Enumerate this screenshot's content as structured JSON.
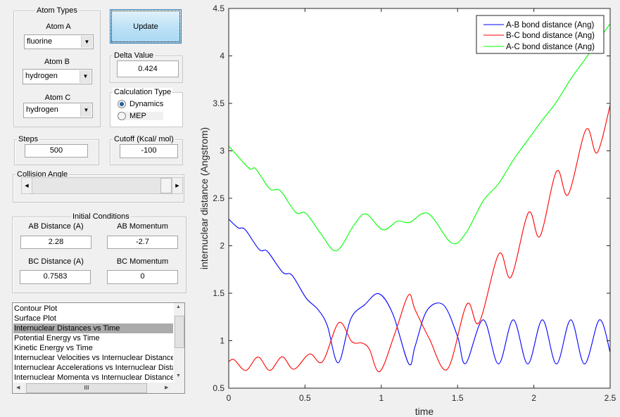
{
  "atom_types": {
    "title": "Atom Types",
    "atom_a": {
      "label": "Atom A",
      "value": "fluorine"
    },
    "atom_b": {
      "label": "Atom B",
      "value": "hydrogen"
    },
    "atom_c": {
      "label": "Atom C",
      "value": "hydrogen"
    }
  },
  "update_label": "Update",
  "delta": {
    "title": "Delta Value",
    "value": "0.424"
  },
  "calc_type": {
    "title": "Calculation Type",
    "options": [
      "Dynamics",
      "MEP"
    ],
    "selected": "Dynamics"
  },
  "steps": {
    "title": "Steps",
    "value": "500"
  },
  "cutoff": {
    "title": "Cutoff (Kcal/ mol)",
    "value": "-100"
  },
  "collision_angle": {
    "title": "Collision Angle",
    "slider_fraction": 1.0
  },
  "initial_conditions": {
    "title": "Initial Conditions",
    "ab_distance": {
      "label": "AB Distance (A)",
      "value": "2.28"
    },
    "ab_momentum": {
      "label": "AB Momentum",
      "value": "-2.7"
    },
    "bc_distance": {
      "label": "BC Distance (A)",
      "value": "0.7583"
    },
    "bc_momentum": {
      "label": "BC Momentum",
      "value": "0"
    }
  },
  "plot_list": {
    "items": [
      "Contour Plot",
      "Surface Plot",
      "Internuclear Distances vs Time",
      "Potential Energy vs Time",
      "Kinetic Energy vs Time",
      "Internuclear Velocities vs Internuclear Distance",
      "Internuclear Accelerations vs Internuclear Distance",
      "Internuclear Momenta vs Internuclear Distance"
    ],
    "selected_index": 2
  },
  "chart_data": {
    "type": "line",
    "xlabel": "time",
    "ylabel": "internuclear distance (Angstrom)",
    "xlim": [
      0,
      2.5
    ],
    "ylim": [
      0.5,
      4.5
    ],
    "xticks": [
      "0",
      "0.5",
      "1",
      "1.5",
      "2",
      "2.5"
    ],
    "yticks": [
      "0.5",
      "1",
      "1.5",
      "2",
      "2.5",
      "3",
      "3.5",
      "4",
      "4.5"
    ],
    "grid": false,
    "legend_position": "top-right",
    "series": [
      {
        "name": "A-B bond distance (Ang)",
        "color": "#0000ff",
        "x": [
          0,
          0.061,
          0.108,
          0.2,
          0.254,
          0.354,
          0.415,
          0.507,
          0.584,
          0.646,
          0.718,
          0.8,
          0.892,
          0.984,
          1.076,
          1.18,
          1.222,
          1.3,
          1.408,
          1.5,
          1.553,
          1.668,
          1.768,
          1.865,
          1.96,
          2.056,
          2.148,
          2.242,
          2.332,
          2.43,
          2.5
        ],
        "y": [
          2.28,
          2.19,
          2.17,
          1.96,
          1.94,
          1.72,
          1.69,
          1.45,
          1.33,
          1.16,
          0.767,
          1.23,
          1.38,
          1.495,
          1.28,
          0.757,
          0.944,
          1.32,
          1.376,
          1.044,
          0.76,
          1.22,
          0.755,
          1.22,
          0.755,
          1.22,
          0.755,
          1.22,
          0.755,
          1.22,
          0.878
        ]
      },
      {
        "name": "B-C bond distance (Ang)",
        "color": "#ff0000",
        "x": [
          0,
          0.035,
          0.112,
          0.192,
          0.269,
          0.35,
          0.427,
          0.53,
          0.615,
          0.722,
          0.807,
          0.876,
          0.922,
          0.99,
          1.09,
          1.178,
          1.222,
          1.315,
          1.433,
          1.561,
          1.641,
          1.771,
          1.85,
          1.965,
          2.04,
          2.149,
          2.225,
          2.342,
          2.414,
          2.5
        ],
        "y": [
          0.779,
          0.8,
          0.687,
          0.828,
          0.687,
          0.83,
          0.7,
          0.86,
          0.78,
          1.19,
          0.99,
          0.975,
          0.91,
          0.675,
          1.08,
          1.48,
          1.325,
          1.02,
          0.7,
          1.385,
          1.19,
          1.915,
          1.67,
          2.35,
          2.1,
          2.785,
          2.54,
          3.225,
          2.98,
          3.48
        ]
      },
      {
        "name": "A-C bond distance (Ang)",
        "color": "#00ff00",
        "x": [
          0,
          0.131,
          0.177,
          0.269,
          0.338,
          0.438,
          0.507,
          0.607,
          0.707,
          0.822,
          0.899,
          1.01,
          1.107,
          1.184,
          1.307,
          1.46,
          1.553,
          1.668,
          1.768,
          1.868,
          1.96,
          2.052,
          2.145,
          2.245,
          2.337,
          2.5
        ],
        "y": [
          3.05,
          2.82,
          2.81,
          2.6,
          2.58,
          2.354,
          2.34,
          2.12,
          1.947,
          2.22,
          2.335,
          2.169,
          2.26,
          2.245,
          2.34,
          2.03,
          2.13,
          2.474,
          2.653,
          2.91,
          3.113,
          3.317,
          3.508,
          3.764,
          3.968,
          4.34
        ]
      }
    ]
  }
}
